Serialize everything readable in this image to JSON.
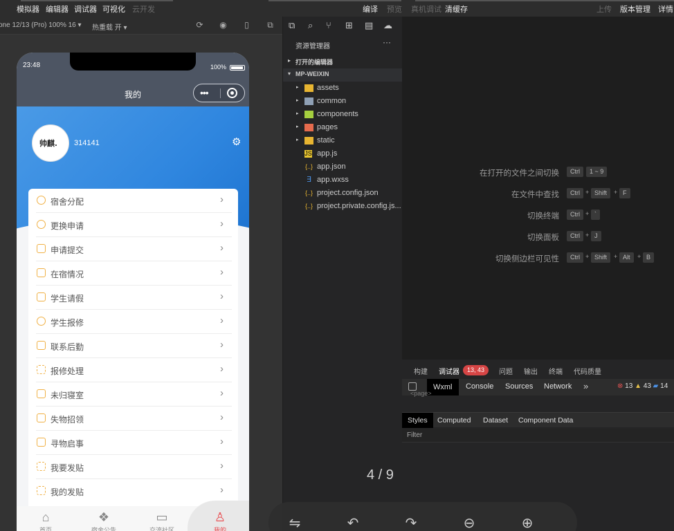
{
  "toolbar": {
    "left": [
      "模拟器",
      "编辑器",
      "调试器",
      "可视化",
      "云开发"
    ],
    "right": [
      "编译",
      "预览",
      "真机调试",
      "清缓存",
      "上传",
      "版本管理",
      "详情"
    ]
  },
  "simulator": {
    "device": "one 12/13 (Pro) 100% 16",
    "hotreload": "热重载 开",
    "status_time": "23:48",
    "battery": "100%",
    "nav_title": "我的",
    "avatar_text": "帅麒.",
    "username": "314141",
    "menu": [
      {
        "label": "宿舍分配"
      },
      {
        "label": "更换申请"
      },
      {
        "label": "申请提交"
      },
      {
        "label": "在宿情况"
      },
      {
        "label": "学生请假"
      },
      {
        "label": "学生报修"
      },
      {
        "label": "联系后勤"
      },
      {
        "label": "报修处理"
      },
      {
        "label": "未归寝室"
      },
      {
        "label": "失物招领"
      },
      {
        "label": "寻物启事"
      },
      {
        "label": "我要发贴"
      },
      {
        "label": "我的发贴"
      }
    ],
    "tabs": [
      {
        "label": "首页",
        "icon": "home-icon"
      },
      {
        "label": "宿舍公告",
        "icon": "grid-icon"
      },
      {
        "label": "交流社区",
        "icon": "chat-icon"
      },
      {
        "label": "我的",
        "icon": "user-icon"
      }
    ]
  },
  "explorer": {
    "title": "资源管理器",
    "more": "···",
    "open_editors": "打开的编辑器",
    "project": "MP-WEIXIN",
    "files": [
      {
        "name": "assets",
        "type": "folder",
        "color": "#e8b531"
      },
      {
        "name": "common",
        "type": "folder",
        "color": "#8fa0b5"
      },
      {
        "name": "components",
        "type": "folder",
        "color": "#a5cf3f"
      },
      {
        "name": "pages",
        "type": "folder",
        "color": "#e66b4d"
      },
      {
        "name": "static",
        "type": "folder",
        "color": "#e8b531"
      },
      {
        "name": "app.js",
        "type": "js",
        "color": "#e8c531"
      },
      {
        "name": "app.json",
        "type": "json",
        "color": "#e8b531"
      },
      {
        "name": "app.wxss",
        "type": "css",
        "color": "#4a8fe0"
      },
      {
        "name": "project.config.json",
        "type": "json",
        "color": "#e8b531"
      },
      {
        "name": "project.private.config.js...",
        "type": "json",
        "color": "#e8b531"
      }
    ]
  },
  "editor": {
    "shortcuts": [
      {
        "label": "在打开的文件之间切换",
        "keys": [
          "Ctrl",
          "1 ~ 9"
        ]
      },
      {
        "label": "在文件中查找",
        "keys": [
          "Ctrl",
          "Shift",
          "F"
        ]
      },
      {
        "label": "切换终端",
        "keys": [
          "Ctrl",
          "`"
        ]
      },
      {
        "label": "切换面板",
        "keys": [
          "Ctrl",
          "J"
        ]
      },
      {
        "label": "切换侧边栏可见性",
        "keys": [
          "Ctrl",
          "Shift",
          "Alt",
          "B"
        ]
      }
    ]
  },
  "debugger": {
    "tabs": [
      "构建",
      "调试器",
      "问题",
      "输出",
      "终端",
      "代码质量"
    ],
    "badge": "13, 43",
    "devtabs": [
      "Wxml",
      "Console",
      "Sources",
      "Network"
    ],
    "more": "»",
    "errors": "13",
    "warnings": "43",
    "infos": "14",
    "page_tag": "<page>",
    "style_tabs": [
      "Styles",
      "Computed",
      "Dataset",
      "Component Data"
    ],
    "filter_label": "Filter"
  },
  "overlay": {
    "counter": "4 / 9"
  }
}
